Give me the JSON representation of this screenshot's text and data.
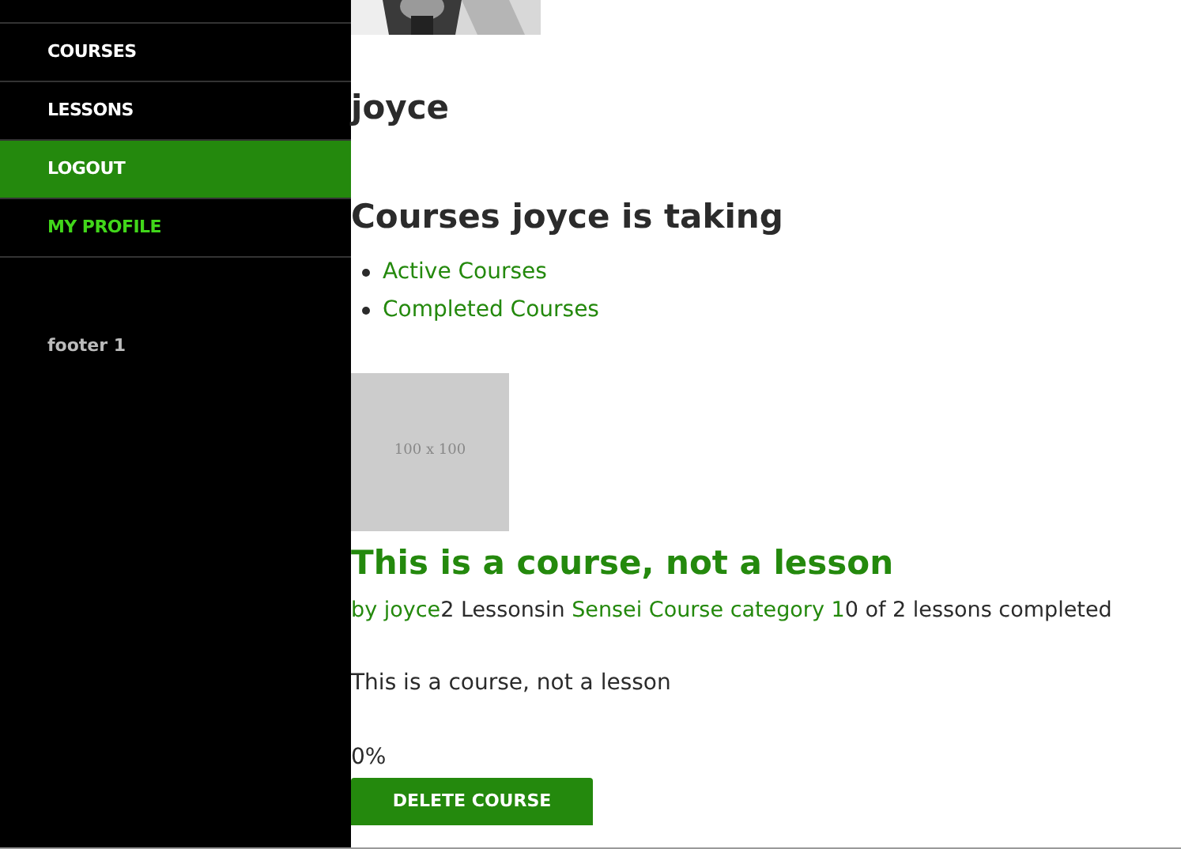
{
  "sidebar": {
    "items": [
      {
        "label": "COURSES",
        "selected": false,
        "current": false
      },
      {
        "label": "LESSONS",
        "selected": false,
        "current": false
      },
      {
        "label": "LOGOUT",
        "selected": true,
        "current": false
      },
      {
        "label": "MY PROFILE",
        "selected": false,
        "current": true
      }
    ],
    "footer": "footer 1"
  },
  "profile": {
    "name": "joyce"
  },
  "courses_heading": "Courses joyce is taking",
  "course_links": [
    "Active Courses",
    "Completed Courses"
  ],
  "course": {
    "thumbnail": "100 x 100",
    "title": "This is a course, not a lesson",
    "meta": [
      {
        "kind": "link",
        "text": "by joyce"
      },
      {
        "kind": "text",
        "text": "2 Lessons"
      },
      {
        "kind": "text",
        "text": "in "
      },
      {
        "kind": "link",
        "text": "Sensei Course category 1"
      },
      {
        "kind": "text",
        "text": "0 of 2 lessons completed"
      }
    ],
    "description": "This is a course, not a lesson",
    "progress": "0%",
    "button": "DELETE COURSE"
  }
}
